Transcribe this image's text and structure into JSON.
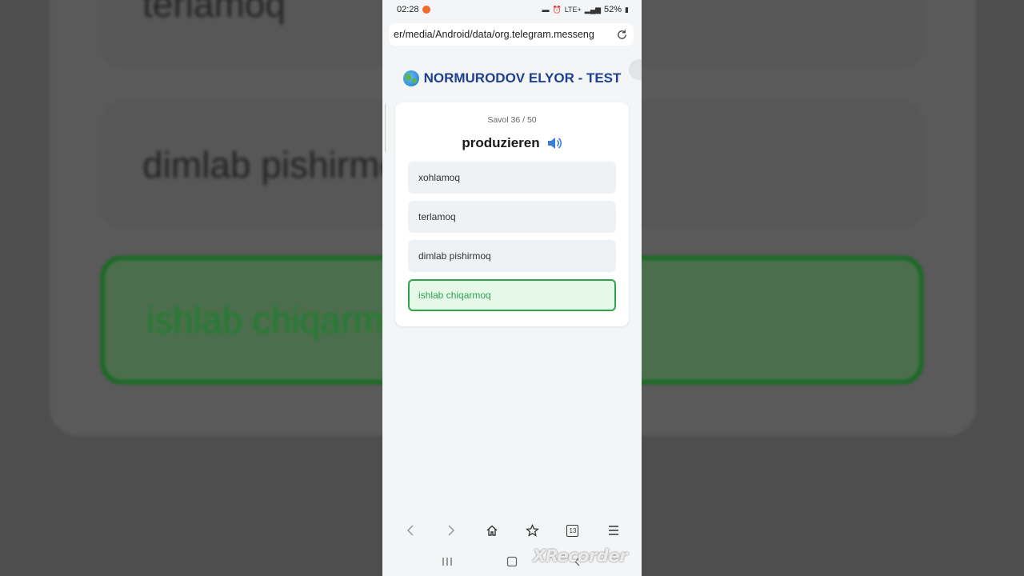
{
  "background": {
    "options": [
      "terlamoq",
      "dimlab pishirmoq",
      "ishlab chiqarmoq"
    ]
  },
  "status_bar": {
    "time": "02:28",
    "network": "LTE+",
    "battery": "52%"
  },
  "browser": {
    "url": "er/media/Android/data/org.telegram.messeng"
  },
  "quiz": {
    "title": "NORMURODOV ELYOR - TEST",
    "title_icon": "globe-icon",
    "counter": "Savol 36 / 50",
    "question": "produzieren",
    "question_icon": "speaker-icon",
    "options": [
      {
        "label": "xohlamoq",
        "state": "default"
      },
      {
        "label": "terlamoq",
        "state": "default"
      },
      {
        "label": "dimlab pishirmoq",
        "state": "default"
      },
      {
        "label": "ishlab chiqarmoq",
        "state": "correct"
      }
    ]
  },
  "nav_bar": {
    "tab_count": "13",
    "items": [
      "back-icon",
      "forward-icon",
      "home-icon",
      "bookmark-icon",
      "tabs-icon",
      "menu-icon"
    ]
  },
  "watermark": "XRecorder",
  "colors": {
    "title": "#1f3f8f",
    "correct": "#2ea44f",
    "correct_bg": "#e6f9e9",
    "option_bg": "#eff2f5"
  }
}
